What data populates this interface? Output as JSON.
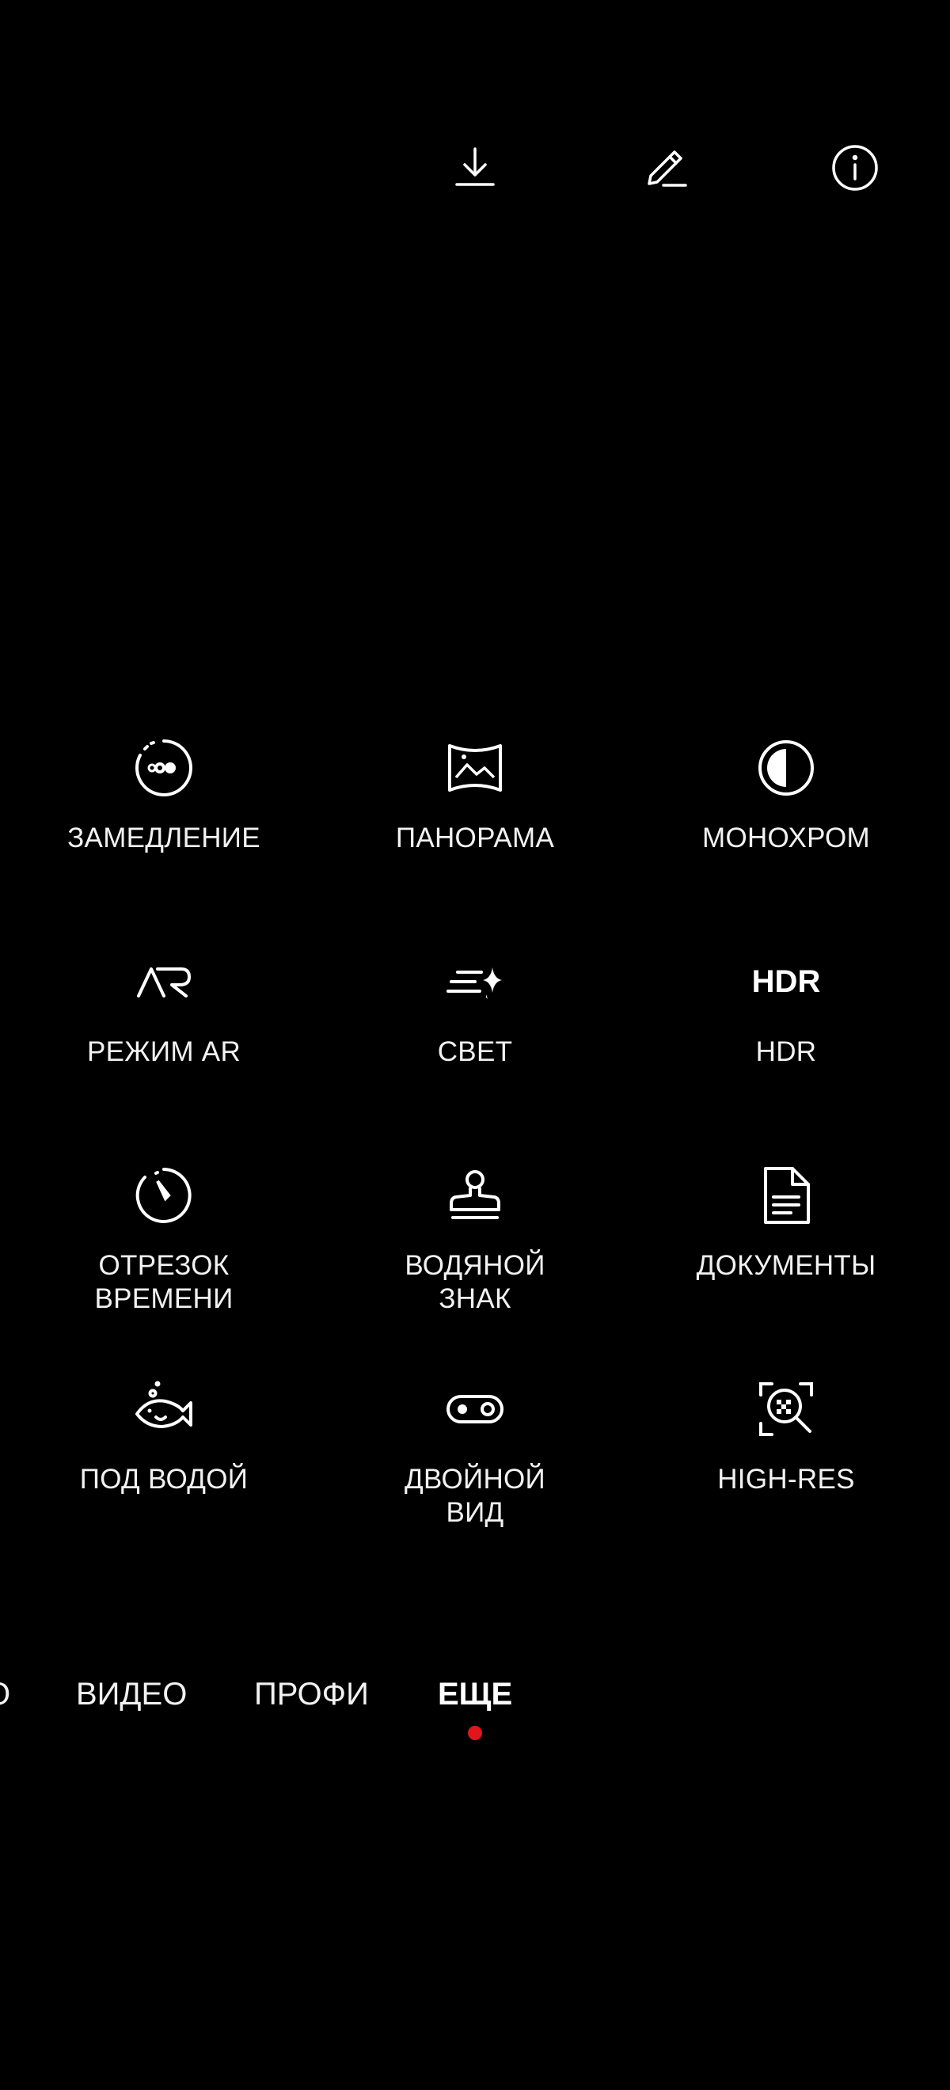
{
  "top_bar": {
    "icons": [
      "download-icon",
      "edit-icon",
      "info-icon"
    ]
  },
  "modes": [
    {
      "icon": "slow-motion-icon",
      "label": "ЗАМЕДЛЕНИЕ"
    },
    {
      "icon": "panorama-icon",
      "label": "ПАНОРАМА"
    },
    {
      "icon": "monochrome-icon",
      "label": "МОНОХРОМ"
    },
    {
      "icon": "ar-icon",
      "label": "РЕЖИМ AR"
    },
    {
      "icon": "light-icon",
      "label": "СВЕТ"
    },
    {
      "icon": "hdr-icon",
      "icon_text": "HDR",
      "label": "HDR"
    },
    {
      "icon": "timelapse-icon",
      "label": "ОТРЕЗОК\nВРЕМЕНИ"
    },
    {
      "icon": "stamp-icon",
      "label": "ВОДЯНОЙ\nЗНАК"
    },
    {
      "icon": "document-icon",
      "label": "ДОКУМЕНТЫ"
    },
    {
      "icon": "fish-icon",
      "label": "ПОД ВОДОЙ"
    },
    {
      "icon": "dual-view-icon",
      "label": "ДВОЙНОЙ\nВИД"
    },
    {
      "icon": "high-res-icon",
      "label": "HIGH-RES"
    }
  ],
  "mode_tabs": {
    "items": [
      "О",
      "ВИДЕО",
      "ПРОФИ",
      "ЕЩЕ"
    ],
    "active": "ЕЩЕ",
    "indicator_color": "#e0161b"
  }
}
